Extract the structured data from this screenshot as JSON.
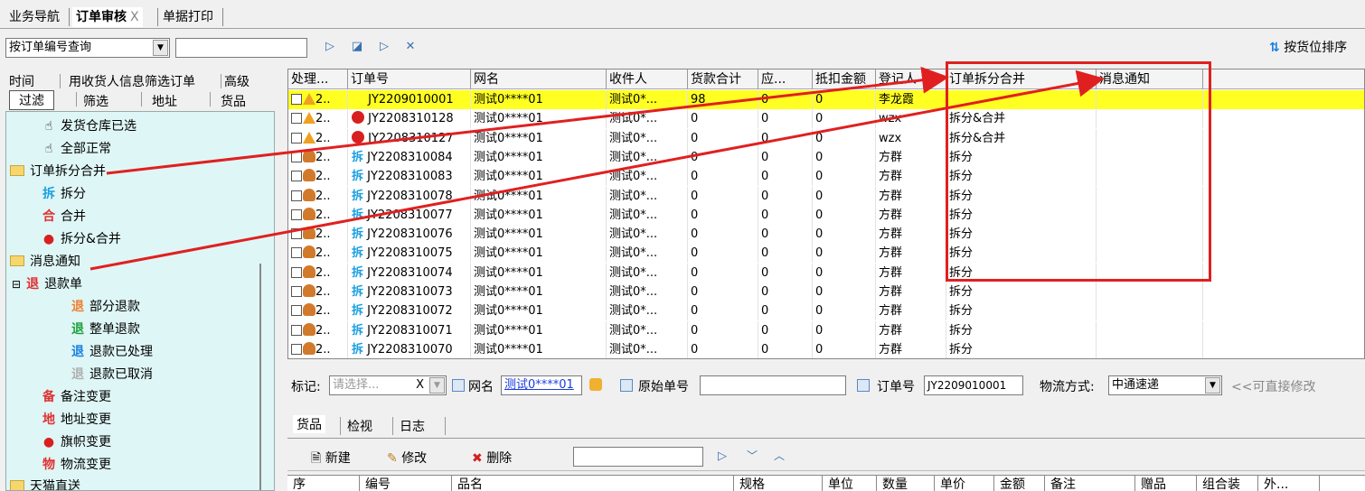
{
  "top_tabs": [
    {
      "label": "业务导航"
    },
    {
      "label": "订单审核",
      "close": "X"
    },
    {
      "label": "单据打印"
    }
  ],
  "toolbar": {
    "query_select": "按订单编号查询",
    "query_input": "",
    "sort_label": "按货位排序"
  },
  "filter_tabs_row1": [
    "时间",
    "用收货人信息筛选订单",
    "高级"
  ],
  "filter_tabs_row2": [
    "过滤",
    "筛选",
    "地址",
    "货品"
  ],
  "tree": [
    {
      "label": "发货仓库已选",
      "icon": "hand-icon",
      "glyph": "☝"
    },
    {
      "label": "全部正常",
      "icon": "hand-icon",
      "glyph": "☝"
    },
    {
      "label": "订单拆分合并",
      "icon": "folder-icon",
      "folder": true
    },
    {
      "label": "拆分",
      "icon": "split-icon",
      "glyph": "拆",
      "color": "#1ba0e0"
    },
    {
      "label": "合并",
      "icon": "merge-icon",
      "glyph": "合",
      "color": "#e03030"
    },
    {
      "label": "拆分&合并",
      "icon": "split-merge-icon",
      "glyph": "●",
      "color": "#d82020"
    },
    {
      "label": "消息通知",
      "icon": "folder-icon",
      "folder": true
    },
    {
      "label": "退款单",
      "icon": "refund-icon",
      "glyph": "退",
      "color": "#e03030",
      "expand": "⊟"
    },
    {
      "label": "部分退款",
      "icon": "refund-partial-icon",
      "glyph": "退",
      "color": "#f08030"
    },
    {
      "label": "整单退款",
      "icon": "refund-full-icon",
      "glyph": "退",
      "color": "#20a040"
    },
    {
      "label": "退款已处理",
      "icon": "refund-done-icon",
      "glyph": "退",
      "color": "#1a80e0"
    },
    {
      "label": "退款已取消",
      "icon": "refund-cancel-icon",
      "glyph": "退",
      "color": "#b0b0b0"
    },
    {
      "label": "备注变更",
      "icon": "remark-icon",
      "glyph": "备",
      "color": "#e03030"
    },
    {
      "label": "地址变更",
      "icon": "address-icon",
      "glyph": "地",
      "color": "#e03030"
    },
    {
      "label": "旗帜变更",
      "icon": "flag-icon",
      "glyph": "●",
      "color": "#d82020"
    },
    {
      "label": "物流变更",
      "icon": "logistics-icon",
      "glyph": "物",
      "color": "#e03030"
    },
    {
      "label": "天猫直送",
      "icon": "folder-icon",
      "folder": true
    }
  ],
  "grid": {
    "columns": [
      "处理...",
      "订单号",
      "网名",
      "收件人",
      "货款合计",
      "应...",
      "抵扣金额",
      "登记人",
      "订单拆分合并",
      "消息通知"
    ],
    "rows": [
      {
        "type": "warn",
        "n": "2..",
        "id": "JY2209010001",
        "name": "测试0****01",
        "recv": "测试0*...",
        "total": "98",
        "due": "0",
        "deduct": "0",
        "reg": "李龙霞",
        "split": "",
        "msg": ""
      },
      {
        "type": "warn-red",
        "n": "2..",
        "id": "JY2208310128",
        "name": "测试0****01",
        "recv": "测试0*...",
        "total": "0",
        "due": "0",
        "deduct": "0",
        "reg": "wzx",
        "split": "拆分&合并",
        "msg": ""
      },
      {
        "type": "warn-red",
        "n": "2..",
        "id": "JY2208310127",
        "name": "测试0****01",
        "recv": "测试0*...",
        "total": "0",
        "due": "0",
        "deduct": "0",
        "reg": "wzx",
        "split": "拆分&合并",
        "msg": ""
      },
      {
        "type": "chai",
        "n": "2..",
        "id": "JY2208310084",
        "name": "测试0****01",
        "recv": "测试0*...",
        "total": "0",
        "due": "0",
        "deduct": "0",
        "reg": "方群",
        "split": "拆分",
        "msg": ""
      },
      {
        "type": "chai",
        "n": "2..",
        "id": "JY2208310083",
        "name": "测试0****01",
        "recv": "测试0*...",
        "total": "0",
        "due": "0",
        "deduct": "0",
        "reg": "方群",
        "split": "拆分",
        "msg": ""
      },
      {
        "type": "chai",
        "n": "2..",
        "id": "JY2208310078",
        "name": "测试0****01",
        "recv": "测试0*...",
        "total": "0",
        "due": "0",
        "deduct": "0",
        "reg": "方群",
        "split": "拆分",
        "msg": ""
      },
      {
        "type": "chai",
        "n": "2..",
        "id": "JY2208310077",
        "name": "测试0****01",
        "recv": "测试0*...",
        "total": "0",
        "due": "0",
        "deduct": "0",
        "reg": "方群",
        "split": "拆分",
        "msg": ""
      },
      {
        "type": "chai",
        "n": "2..",
        "id": "JY2208310076",
        "name": "测试0****01",
        "recv": "测试0*...",
        "total": "0",
        "due": "0",
        "deduct": "0",
        "reg": "方群",
        "split": "拆分",
        "msg": ""
      },
      {
        "type": "chai",
        "n": "2..",
        "id": "JY2208310075",
        "name": "测试0****01",
        "recv": "测试0*...",
        "total": "0",
        "due": "0",
        "deduct": "0",
        "reg": "方群",
        "split": "拆分",
        "msg": ""
      },
      {
        "type": "chai",
        "n": "2..",
        "id": "JY2208310074",
        "name": "测试0****01",
        "recv": "测试0*...",
        "total": "0",
        "due": "0",
        "deduct": "0",
        "reg": "方群",
        "split": "拆分",
        "msg": ""
      },
      {
        "type": "chai",
        "n": "2..",
        "id": "JY2208310073",
        "name": "测试0****01",
        "recv": "测试0*...",
        "total": "0",
        "due": "0",
        "deduct": "0",
        "reg": "方群",
        "split": "拆分",
        "msg": ""
      },
      {
        "type": "chai",
        "n": "2..",
        "id": "JY2208310072",
        "name": "测试0****01",
        "recv": "测试0*...",
        "total": "0",
        "due": "0",
        "deduct": "0",
        "reg": "方群",
        "split": "拆分",
        "msg": ""
      },
      {
        "type": "chai",
        "n": "2..",
        "id": "JY2208310071",
        "name": "测试0****01",
        "recv": "测试0*...",
        "total": "0",
        "due": "0",
        "deduct": "0",
        "reg": "方群",
        "split": "拆分",
        "msg": ""
      },
      {
        "type": "chai",
        "n": "2..",
        "id": "JY2208310070",
        "name": "测试0****01",
        "recv": "测试0*...",
        "total": "0",
        "due": "0",
        "deduct": "0",
        "reg": "方群",
        "split": "拆分",
        "msg": ""
      }
    ]
  },
  "infobar": {
    "mark_label": "标记:",
    "mark_placeholder": "请选择...",
    "mark_clear": "X",
    "netname_label": "网名",
    "netname_value": "测试0****01",
    "orig_label": "原始单号",
    "orig_value": "",
    "order_label": "订单号",
    "order_value": "JY2209010001",
    "logistics_label": "物流方式:",
    "logistics_value": "中通速递",
    "hint": "<<可直接修改"
  },
  "bottom_tabs": [
    "货品",
    "检视",
    "日志"
  ],
  "bottom_toolbar": {
    "new": "新建",
    "edit": "修改",
    "delete": "删除",
    "search": ""
  },
  "bottom_columns": [
    "序",
    "编号",
    "品名",
    "规格",
    "单位",
    "数量",
    "单价",
    "金额",
    "备注",
    "赠品",
    "组合装",
    "外..."
  ],
  "colors": {
    "highlight_row": "#ffff22",
    "annotation": "#e02020",
    "tree_bg": "#dff6f6",
    "chai": "#1ba0e0"
  }
}
